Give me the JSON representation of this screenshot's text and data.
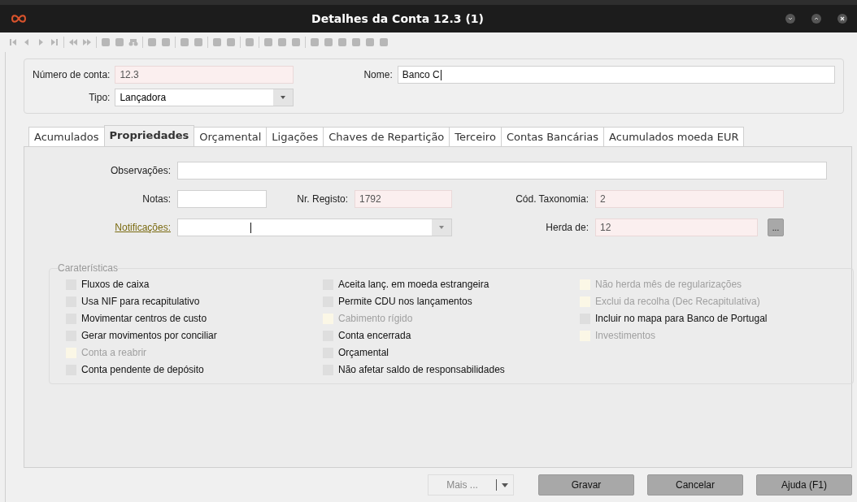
{
  "window": {
    "title": "Detalhes da Conta 12.3 (1)"
  },
  "header": {
    "account_number": {
      "label": "Número de conta:",
      "value": "12.3"
    },
    "type": {
      "label": "Tipo:",
      "value": "Lançadora"
    },
    "name": {
      "label": "Nome:",
      "value": "Banco C"
    }
  },
  "tabs": [
    {
      "label": "Acumulados",
      "selected": false
    },
    {
      "label": "Propriedades",
      "selected": true
    },
    {
      "label": "Orçamental",
      "selected": false
    },
    {
      "label": "Ligações",
      "selected": false
    },
    {
      "label": "Chaves de Repartição",
      "selected": false
    },
    {
      "label": "Terceiro",
      "selected": false
    },
    {
      "label": "Contas Bancárias",
      "selected": false
    },
    {
      "label": "Acumulados moeda EUR",
      "selected": false
    }
  ],
  "fields": {
    "observacoes": {
      "label": "Observações:"
    },
    "notas": {
      "label": "Notas:"
    },
    "nr_registo": {
      "label": "Nr. Registo:",
      "value": "1792"
    },
    "cod_taxonomia": {
      "label": "Cód. Taxonomia:",
      "value": "2"
    },
    "notificacoes": {
      "label": "Notificações:"
    },
    "herda_de": {
      "label": "Herda de:",
      "value": "12",
      "button": "..."
    }
  },
  "characteristics": {
    "title": "Caraterísticas",
    "columns": [
      [
        {
          "label": "Fluxos de caixa",
          "checked": false,
          "disabled": false
        },
        {
          "label": "Usa NIF para recapitulativo",
          "checked": false,
          "disabled": false
        },
        {
          "label": "Movimentar centros de custo",
          "checked": false,
          "disabled": false
        },
        {
          "label": "Gerar movimentos por conciliar",
          "checked": false,
          "disabled": false
        },
        {
          "label": "Conta a reabrir",
          "checked": false,
          "disabled": true
        },
        {
          "label": "Conta pendente de depósito",
          "checked": false,
          "disabled": false
        }
      ],
      [
        {
          "label": "Aceita lanç. em moeda estrangeira",
          "checked": false,
          "disabled": false
        },
        {
          "label": "Permite CDU nos lançamentos",
          "checked": false,
          "disabled": false
        },
        {
          "label": "Cabimento rígido",
          "checked": false,
          "disabled": true
        },
        {
          "label": "Conta encerrada",
          "checked": false,
          "disabled": false
        },
        {
          "label": "Orçamental",
          "checked": false,
          "disabled": false
        },
        {
          "label": "Não afetar saldo de responsabilidades",
          "checked": false,
          "disabled": false
        }
      ],
      [
        {
          "label": "Não herda mês de regularizações",
          "checked": false,
          "disabled": true
        },
        {
          "label": "Exclui da recolha (Dec Recapitulativa)",
          "checked": false,
          "disabled": true
        },
        {
          "label": "Incluir no mapa para Banco de Portugal",
          "checked": false,
          "disabled": false
        },
        {
          "label": "Investimentos",
          "checked": false,
          "disabled": true
        }
      ]
    ]
  },
  "buttons": [
    {
      "label": "Mais ...",
      "kind": "split",
      "disabled": true
    },
    {
      "label": "Gravar",
      "kind": "plain",
      "disabled": false
    },
    {
      "label": "Cancelar",
      "kind": "plain",
      "disabled": false
    },
    {
      "label": "Ajuda (F1)",
      "kind": "plain",
      "disabled": false
    }
  ]
}
